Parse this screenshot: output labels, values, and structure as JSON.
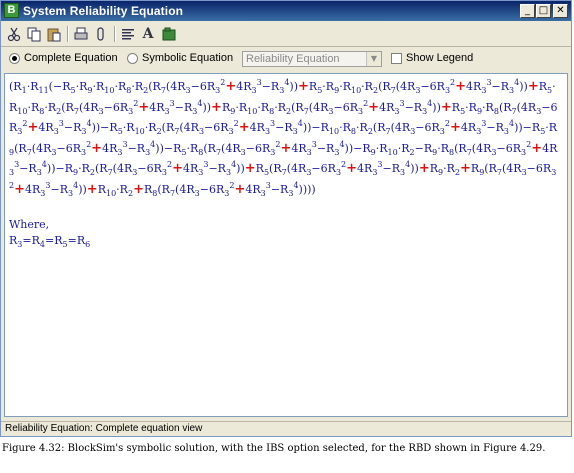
{
  "window": {
    "title": "System Reliability Equation",
    "app_icon_glyph": "B",
    "controls": {
      "minimize": "_",
      "maximize": "□",
      "close": "✕"
    }
  },
  "toolbar": {
    "icons": [
      "cut-icon",
      "copy-icon",
      "paste-icon",
      "print-icon",
      "clip-icon",
      "align-icon",
      "font-icon",
      "export-icon"
    ]
  },
  "options": {
    "complete_label": "Complete Equation",
    "complete_selected": true,
    "symbolic_label": "Symbolic Equation",
    "symbolic_selected": false,
    "equation_select_value": "Reliability Equation",
    "show_legend_label": "Show Legend",
    "show_legend_checked": false
  },
  "equation": {
    "text": "(R1·R11(−R5·R9·R10·R8·R2(R7(4R3−6R3^2+4R3^3−R3^4))+R5·R9·R10·R2(R7(4R3−6R3^2+4R3^3−R3^4))+R5·R10·R8·R2(R7(4R3−6R3^2+4R3^3−R3^4))+R9·R10·R8·R2(R7(4R3−6R3^2+4R3^3−R3^4))+R5·R9·R8(R7(4R3−6R3^2+4R3^3−R3^4))−R5·R10·R2(R7(4R3−6R3^2+4R3^3−R3^4))−R10·R8·R2(R7(4R3−6R3^2+4R3^3−R3^4))−R5·R9(R7(4R3−6R3^2+4R3^3−R3^4))−R5·R8(R7(4R3−6R3^2+4R3^3−R3^4))−R9·R10·R2−R9·R8(R7(4R3−6R3^2+4R3^3−R3^4))−R9·R2(R7(4R3−6R3^2+4R3^3−R3^4))+R5(R7(4R3−6R3^2+4R3^3−R3^4))+R9·R2+R9(R7(4R3−6R3^2+4R3^3−R3^4))+R10·R2+R8(R7(4R3−6R3^2+4R3^3−R3^4))))",
    "where_label": "Where,",
    "condition": "R3=R4=R5=R6"
  },
  "status": {
    "text": "Reliability Equation: Complete equation view"
  },
  "caption": "Figure 4.32: BlockSim's symbolic solution, with the IBS option selected, for the RBD shown in Figure 4.29."
}
